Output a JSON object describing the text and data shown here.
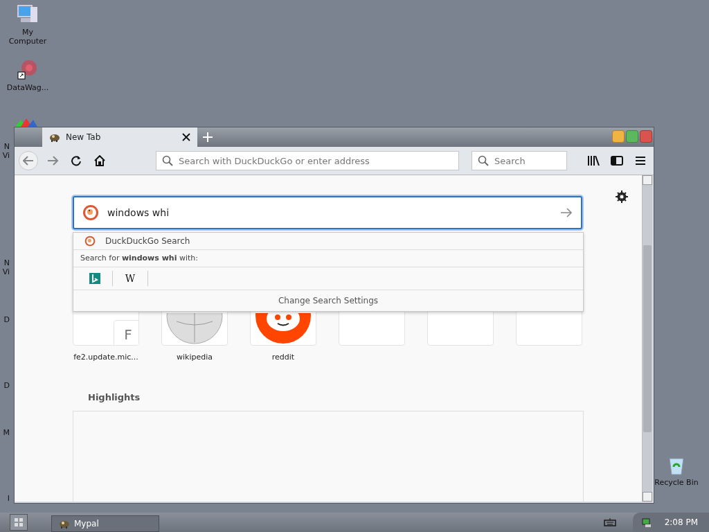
{
  "desktop_icons": [
    {
      "kind": "computer",
      "lines": [
        "My",
        "Computer"
      ]
    },
    {
      "kind": "datawag",
      "lines": [
        "DataWag..."
      ]
    }
  ],
  "desktop_hidden_labels": [
    {
      "lines": [
        "N",
        "Vi"
      ]
    },
    {
      "lines": [
        "N",
        "Vi"
      ]
    },
    {
      "lines": [
        "D"
      ]
    },
    {
      "lines": [
        "D"
      ]
    },
    {
      "lines": [
        "M"
      ]
    },
    {
      "lines": [
        "I"
      ]
    }
  ],
  "recycle_bin": {
    "label": "Recycle Bin"
  },
  "browser": {
    "tabs": [
      {
        "title": "New Tab",
        "selected": true
      }
    ],
    "address_bar": {
      "placeholder": "Search with DuckDuckGo or enter address"
    },
    "search_bar": {
      "placeholder": "Search"
    },
    "page_search": {
      "value": "windows whi"
    },
    "dropdown": {
      "engine": "DuckDuckGo Search",
      "search_for": "Search for **windows whi** with:",
      "engines": [
        {
          "kind": "bing"
        },
        {
          "kind": "wikipedia",
          "label": "W"
        }
      ],
      "settings": "Change Search Settings"
    },
    "top_sites": [
      {
        "kind": "letter",
        "letter": "F",
        "label": "fe2.update.mic..."
      },
      {
        "kind": "wikipedia",
        "label": "wikipedia"
      },
      {
        "kind": "reddit",
        "label": "reddit"
      },
      {
        "kind": "empty"
      },
      {
        "kind": "empty"
      },
      {
        "kind": "empty"
      }
    ],
    "highlights": {
      "title": "Highlights"
    }
  },
  "taskbar": {
    "items": [
      {
        "label": "Mypal",
        "selected": true
      }
    ],
    "clock": "2:08 PM"
  }
}
